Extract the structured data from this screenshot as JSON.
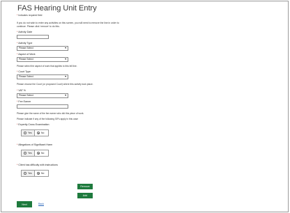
{
  "page": {
    "title": "FAS Hearing Unit Entry",
    "required_note": "Indicates required field",
    "info_text": "If you do not wish to enter any activities on this screen, you will need to remove the line in order to continue. Please click 'remove' to do this."
  },
  "form": {
    "activity_date": {
      "label": "Activity Date",
      "value": ""
    },
    "activity_type": {
      "label": "Activity Type",
      "value": "Please Select"
    },
    "aspect_of_work": {
      "label": "Aspect of Work",
      "value": "Please Select",
      "help": "Please select the aspect of work that applies to this bill line."
    },
    "court_type": {
      "label": "Court Type",
      "value": "Please Select",
      "help": "Please choose the Court (or proposed Court) where this activity took place."
    },
    "vat": {
      "label": "VAT %",
      "value": "Please Select"
    },
    "fee_earner": {
      "label": "Fee Earner",
      "value": "",
      "help": "Please give the name of the fee earner who did this piece of work."
    },
    "factors_intro": "Please indicate if any of the following SIFs apply in this case",
    "expert_cross_exam": {
      "label": "Expertly Cross Examination",
      "yes": "Yes",
      "no": "No",
      "selected": "No"
    },
    "allegations": {
      "label": "Allegations of Significant Harm",
      "yes": "Yes",
      "no": "No",
      "selected": "No"
    },
    "client_difficulty": {
      "label": "Client has difficulty with instructions",
      "yes": "Yes",
      "no": "No",
      "selected": "No"
    }
  },
  "actions": {
    "remove": "Remove",
    "add": "Add",
    "next": "Next",
    "back": "Back"
  },
  "colors": {
    "primary_button": "#1e7a3d",
    "link": "#2563b8",
    "required": "#c0392b"
  },
  "icons": {
    "dropdown": "chevron-down-icon"
  }
}
